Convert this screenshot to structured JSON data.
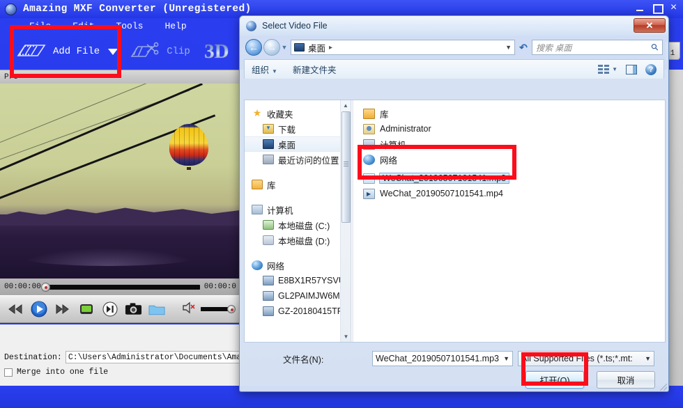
{
  "app": {
    "title": "Amazing MXF Converter (Unregistered)",
    "logo_icon": "app-logo-icon",
    "window_controls": {
      "minimize": "minimize-icon",
      "maximize": "maximize-icon",
      "close": "×"
    },
    "menu": [
      "File",
      "Edit",
      "Tools",
      "Help"
    ],
    "toolbar": [
      {
        "label": "Add File",
        "icon": "film-strip-icon",
        "has_dropdown": true
      },
      {
        "label": "Clip",
        "icon": "clip-scissors-icon",
        "has_dropdown": false
      },
      {
        "label": "3D",
        "icon": "3d-cube-icon",
        "has_dropdown": false
      }
    ],
    "preview_label": "Pre",
    "player": {
      "time_current": "00:00:00",
      "time_total": "00:00:0",
      "buttons": [
        "rewind-icon",
        "play-icon",
        "fast-forward-icon",
        "stop-icon",
        "next-frame-icon",
        "snapshot-icon",
        "open-folder-icon"
      ],
      "volume_icon": "volume-muted-icon"
    },
    "destination": {
      "label": "Destination:",
      "path": "C:\\Users\\Administrator\\Documents\\Amazing S"
    },
    "merge": {
      "label": "Merge into one file",
      "checked": false
    },
    "edge_tab_label": "1"
  },
  "dialog": {
    "title": "Select Video File",
    "title_icon": "video-file-icon",
    "close_label": "✕",
    "nav": {
      "back_icon": "back-arrow-icon",
      "forward_icon": "forward-arrow-icon",
      "history_icon": "chevron-down-icon",
      "address_icon": "desktop-icon",
      "address_text": "桌面",
      "address_separator": "▸",
      "address_caret": "▼",
      "refresh_icon": "refresh-icon",
      "search_placeholder": "搜索 桌面",
      "search_icon": "search-icon"
    },
    "toolbar": {
      "organize": "组织",
      "new_folder": "新建文件夹",
      "view_icon": "list-view-icon",
      "preview_pane_icon": "preview-pane-icon",
      "help_icon": "help-icon"
    },
    "sidebar": [
      {
        "label": "收藏夹",
        "icon": "favorites-star-icon",
        "level": 0,
        "selected": false
      },
      {
        "label": "下载",
        "icon": "downloads-icon",
        "level": 1,
        "selected": false
      },
      {
        "label": "桌面",
        "icon": "desktop-icon",
        "level": 1,
        "selected": true
      },
      {
        "label": "最近访问的位置",
        "icon": "recent-places-icon",
        "level": 1,
        "selected": false
      },
      {
        "label": "库",
        "icon": "library-icon",
        "level": 0,
        "selected": false
      },
      {
        "label": "计算机",
        "icon": "computer-icon",
        "level": 0,
        "selected": false
      },
      {
        "label": "本地磁盘 (C:)",
        "icon": "local-disk-c-icon",
        "level": 1,
        "selected": false
      },
      {
        "label": "本地磁盘 (D:)",
        "icon": "local-disk-d-icon",
        "level": 1,
        "selected": false
      },
      {
        "label": "网络",
        "icon": "network-icon",
        "level": 0,
        "selected": false
      },
      {
        "label": "E8BX1R57YSVU",
        "icon": "network-computer-icon",
        "level": 1,
        "selected": false
      },
      {
        "label": "GL2PAIMJW6M",
        "icon": "network-computer-icon",
        "level": 1,
        "selected": false
      },
      {
        "label": "GZ-20180415TF",
        "icon": "network-computer-icon",
        "level": 1,
        "selected": false
      }
    ],
    "files": [
      {
        "name": "库",
        "icon": "library-icon",
        "selected": false
      },
      {
        "name": "Administrator",
        "icon": "user-folder-icon",
        "selected": false
      },
      {
        "name": "计算机",
        "icon": "computer-icon",
        "selected": false
      },
      {
        "name": "网络",
        "icon": "network-icon",
        "selected": false
      },
      {
        "name": "WeChat_20190507101541.mp3",
        "icon": "audio-file-icon",
        "selected": true
      },
      {
        "name": "WeChat_20190507101541.mp4",
        "icon": "video-file-icon",
        "selected": false
      }
    ],
    "footer": {
      "filename_label": "文件名(N):",
      "filename_value": "WeChat_20190507101541.mp3",
      "filter_value": "All Supported Files (*.ts;*.mt:",
      "open_button": "打开(O)",
      "cancel_button": "取消",
      "dropdown_caret": "▼"
    }
  },
  "annotations": {
    "color": "#fc0d1b",
    "boxes": [
      "add-file-button",
      "wechat-files",
      "open-button"
    ]
  }
}
